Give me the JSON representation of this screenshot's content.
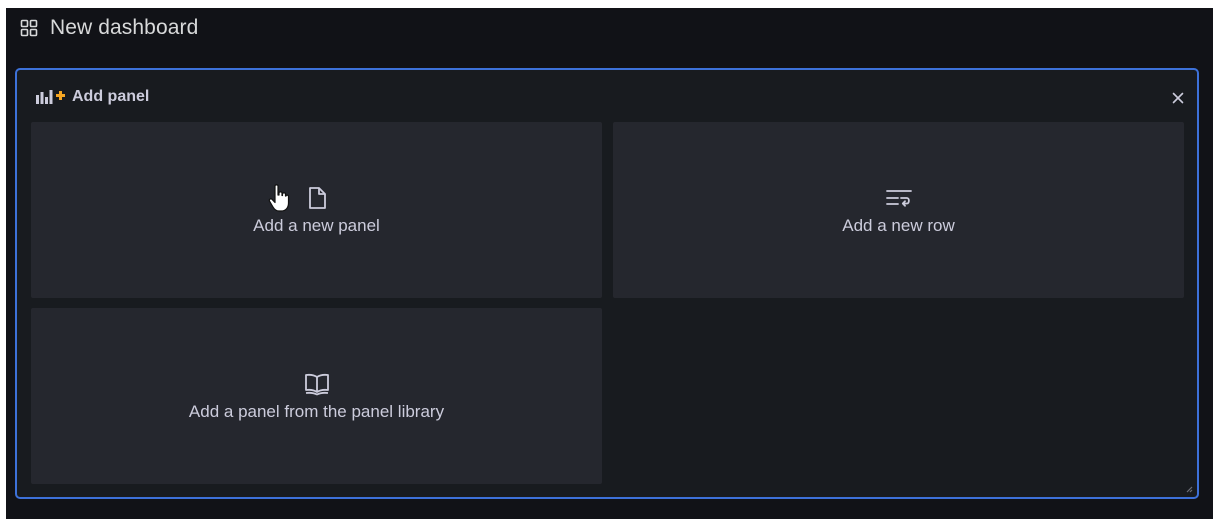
{
  "dashboard": {
    "title": "New dashboard",
    "icon": "dashboard-grid-icon"
  },
  "add_panel": {
    "header_label": "Add panel",
    "header_icon": "add-panel-chart-icon",
    "close_icon": "close-icon",
    "accent_color": "#3d71d9",
    "plus_color": "#f5a623",
    "options": [
      {
        "label": "Add a new panel",
        "icon": "file-icon"
      },
      {
        "label": "Add a new row",
        "icon": "row-wrap-icon"
      },
      {
        "label": "Add a panel from the panel library",
        "icon": "book-open-icon"
      }
    ]
  }
}
